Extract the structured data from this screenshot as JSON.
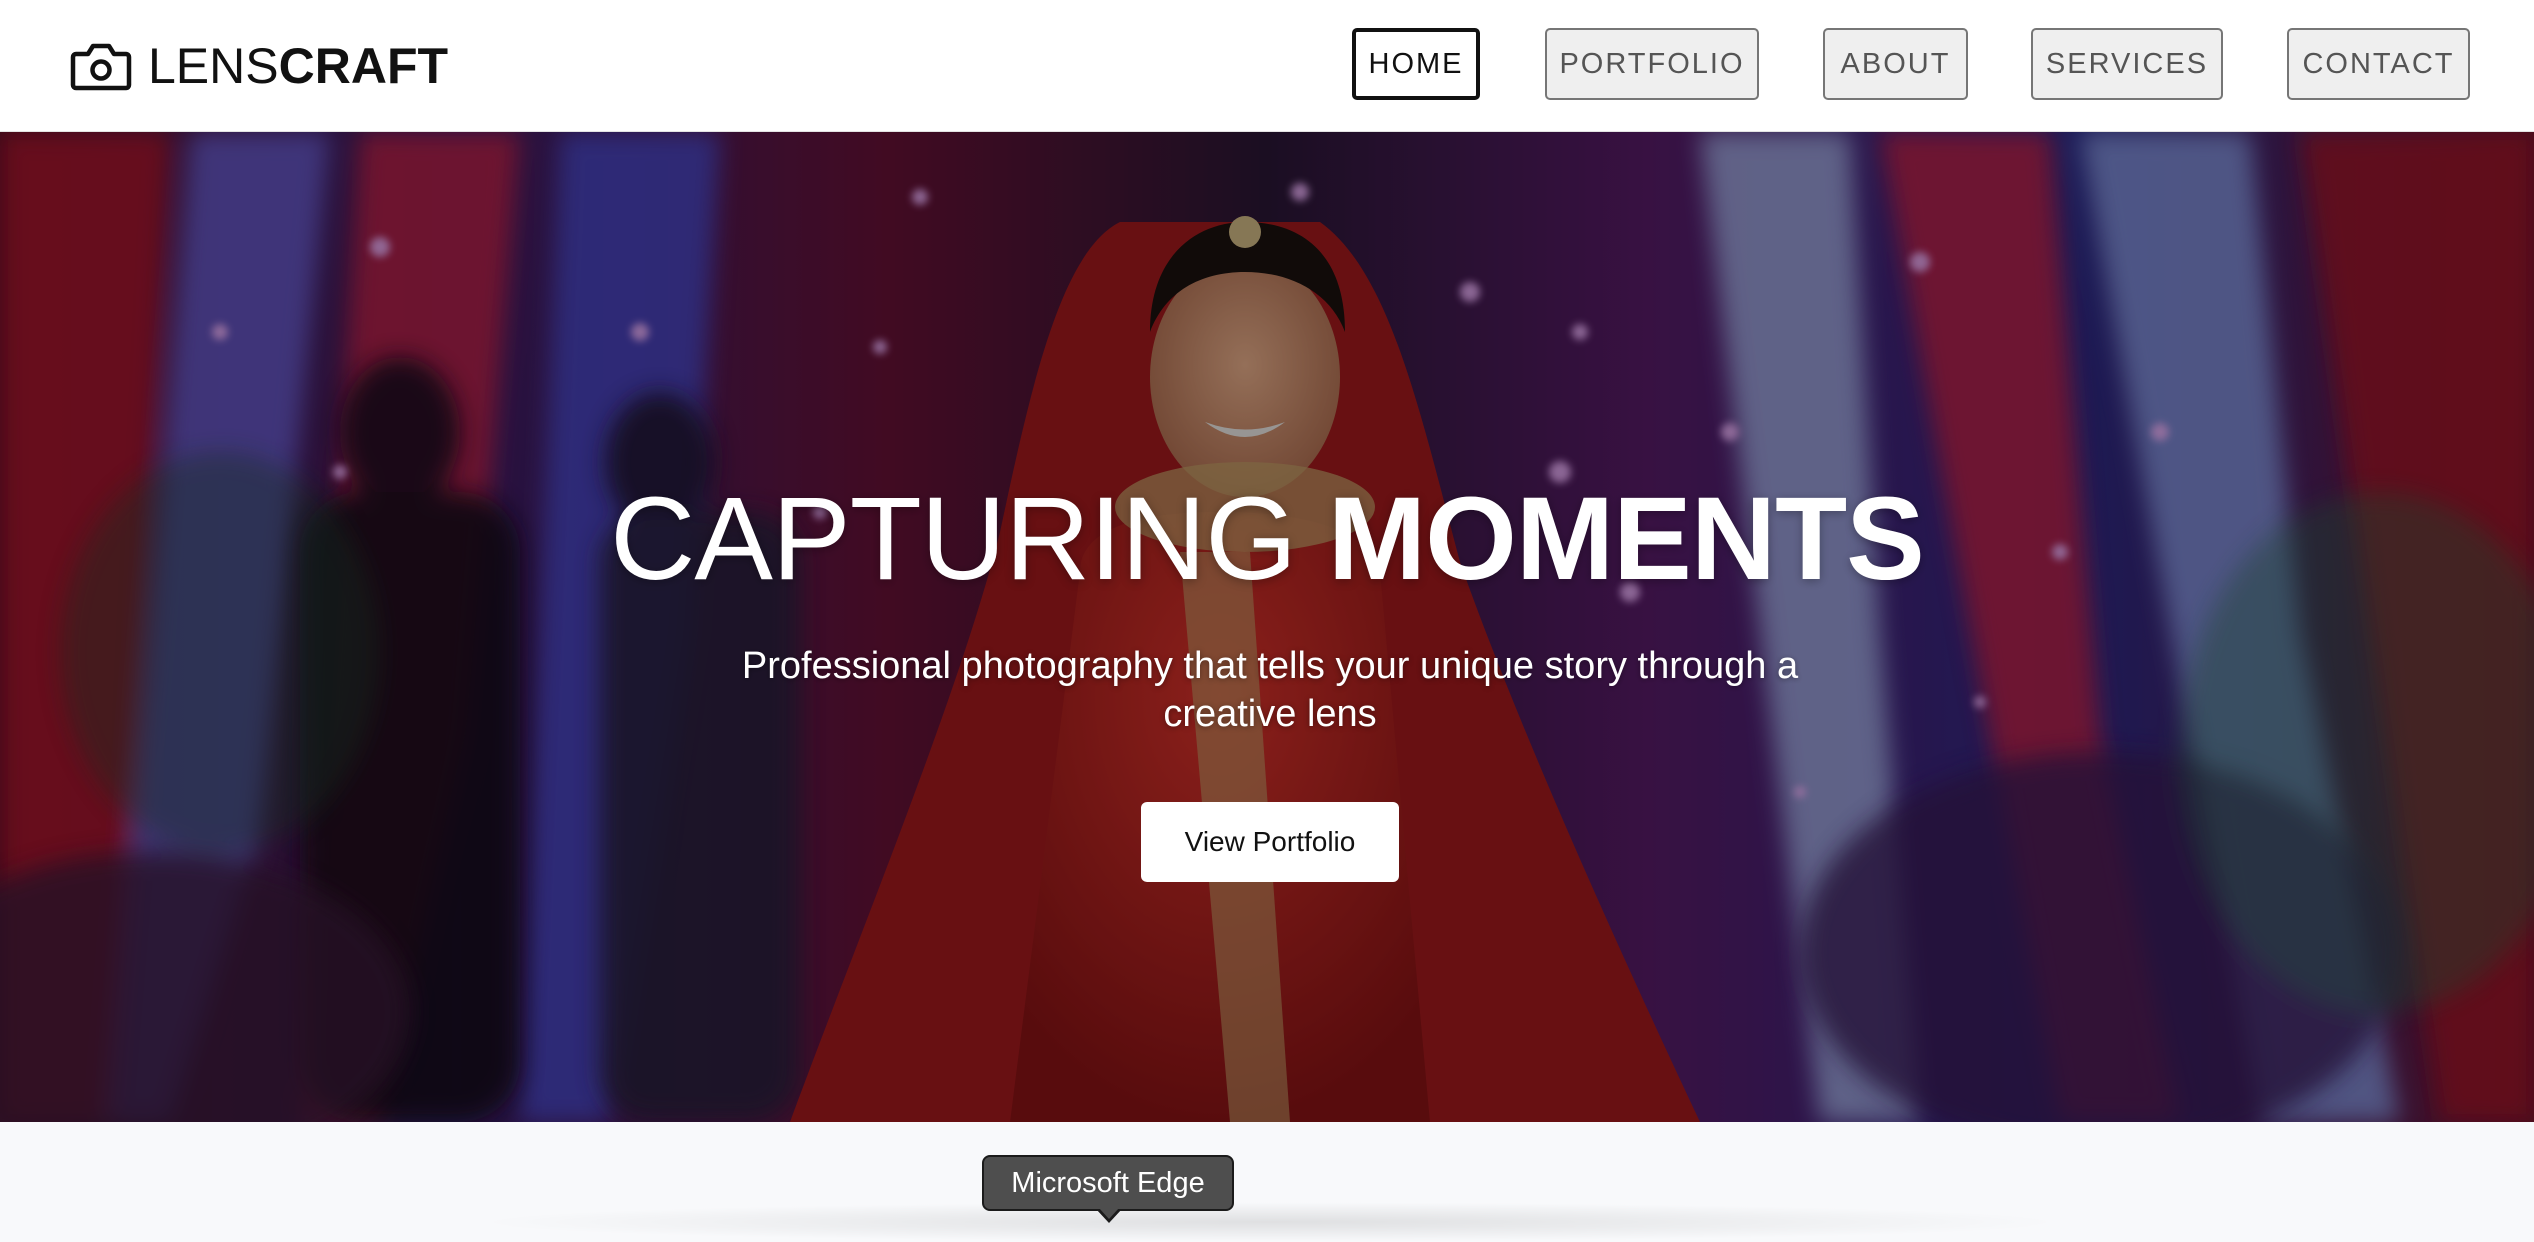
{
  "brand": {
    "icon": "camera-icon",
    "name_light": "LENS",
    "name_bold": "CRAFT"
  },
  "nav": {
    "items": [
      {
        "label": "HOME",
        "active": true
      },
      {
        "label": "PORTFOLIO",
        "active": false
      },
      {
        "label": "ABOUT",
        "active": false
      },
      {
        "label": "SERVICES",
        "active": false
      },
      {
        "label": "CONTACT",
        "active": false
      }
    ]
  },
  "hero": {
    "title_light": "CAPTURING",
    "title_bold": "MOMENTS",
    "subtitle": "Professional photography that tells your unique story through a creative lens",
    "cta_label": "View Portfolio"
  },
  "dock": {
    "tooltip": "Microsoft Edge"
  },
  "colors": {
    "header_bg": "#ffffff",
    "text_dark": "#111111",
    "nav_inactive_bg": "#efefef",
    "nav_inactive_text": "#555555",
    "hero_text": "#ffffff",
    "tooltip_bg": "#4e4e4e"
  }
}
